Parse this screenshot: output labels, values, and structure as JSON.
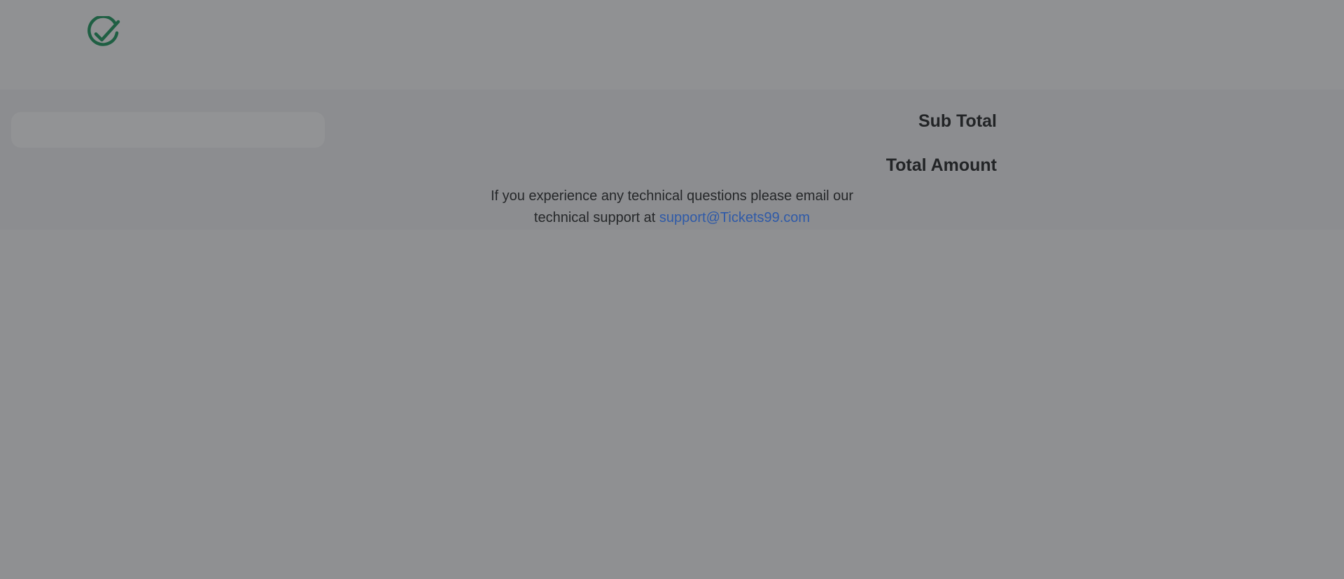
{
  "header": {
    "icon": "check-circle-icon",
    "accent_color": "#1f5f43"
  },
  "summary": {
    "sub_total_label": "Sub Total",
    "total_amount_label": "Total Amount"
  },
  "support": {
    "line1": "If you experience any technical questions please email our",
    "line2_prefix": "technical support at ",
    "email": "support@Tickets99.com"
  }
}
